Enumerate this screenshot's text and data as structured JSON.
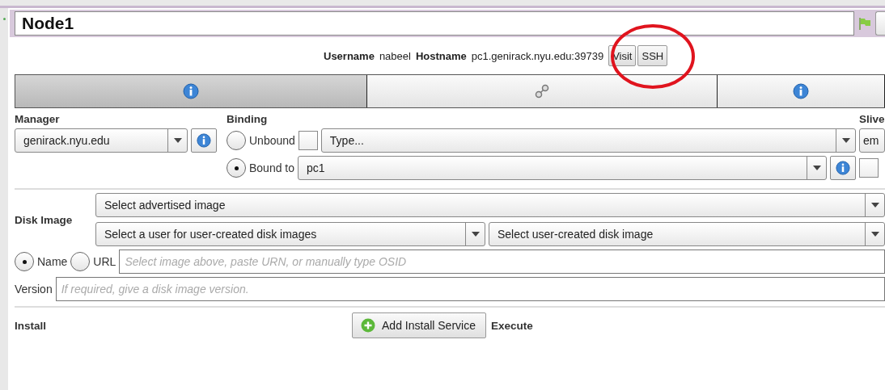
{
  "node": {
    "name": "Node1"
  },
  "info": {
    "username_label": "Username",
    "username": "nabeel",
    "hostname_label": "Hostname",
    "hostname": "pc1.genirack.nyu.edu:39739",
    "buttons": [
      "Visit",
      "SSH"
    ]
  },
  "tabs": [
    {
      "kind": "info",
      "selected": true
    },
    {
      "kind": "link",
      "selected": false
    },
    {
      "kind": "info",
      "selected": false
    }
  ],
  "manager": {
    "label": "Manager",
    "value": "genirack.nyu.edu"
  },
  "binding": {
    "label": "Binding",
    "unbound_checked": false,
    "type_value": "Type...",
    "bound_value": "pc1",
    "options": [
      {
        "label": "Unbound",
        "selected": false
      },
      {
        "label": "Bound to",
        "selected": true
      }
    ]
  },
  "sliver": {
    "label": "Slive",
    "value": "em",
    "checked": false
  },
  "disk_image": {
    "label": "Disk Image",
    "advertised": "Select advertised image",
    "user": "Select a user for user-created disk images",
    "user_image": "Select user-created disk image",
    "urn_placeholder": "Select image above, paste URN, or manually type OSID",
    "source_options": [
      {
        "label": "Name",
        "selected": true
      },
      {
        "label": "URL",
        "selected": false
      }
    ]
  },
  "version": {
    "label": "Version",
    "placeholder": "If required, give a disk image version."
  },
  "install": {
    "label": "Install",
    "button": "Add Install Service"
  },
  "execute": {
    "label": "Execute"
  }
}
